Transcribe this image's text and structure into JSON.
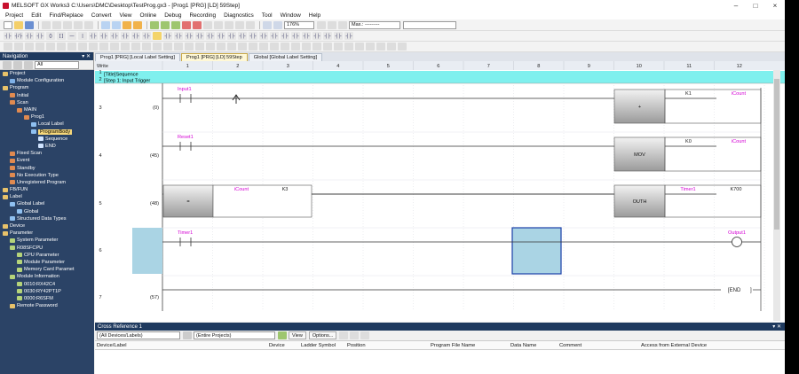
{
  "window": {
    "title": "MELSOFT GX Works3 C:\\Users\\DMC\\Desktop\\TestProg.gx3 - [Prog1 [PRG] [LD] 59Step]"
  },
  "menu": [
    "Project",
    "Edit",
    "Find/Replace",
    "Convert",
    "View",
    "Online",
    "Debug",
    "Recording",
    "Diagnostics",
    "Tool",
    "Window",
    "Help"
  ],
  "toolbar": {
    "zoom": "176%",
    "device_combo": "Max.: ---------"
  },
  "navigation": {
    "title": "Navigation",
    "filter": "All",
    "tree": [
      {
        "label": "Project",
        "depth": 0,
        "color": "#e8c26a"
      },
      {
        "label": "Module Configuration",
        "depth": 1,
        "color": "#7fb0e6"
      },
      {
        "label": "Program",
        "depth": 0,
        "color": "#e8c26a"
      },
      {
        "label": "Initial",
        "depth": 1,
        "color": "#e08a50"
      },
      {
        "label": "Scan",
        "depth": 1,
        "color": "#e08a50"
      },
      {
        "label": "MAIN",
        "depth": 2,
        "color": "#e08a50"
      },
      {
        "label": "Prog1",
        "depth": 3,
        "color": "#e08a50"
      },
      {
        "label": "Local Label",
        "depth": 4,
        "color": "#8fc0f0"
      },
      {
        "label": "ProgramBody",
        "depth": 4,
        "color": "#8fc0f0",
        "selected": true
      },
      {
        "label": "Sequence",
        "depth": 5,
        "color": "#cfe3ff"
      },
      {
        "label": "END",
        "depth": 5,
        "color": "#cfe3ff"
      },
      {
        "label": "Fixed Scan",
        "depth": 1,
        "color": "#e08a50"
      },
      {
        "label": "Event",
        "depth": 1,
        "color": "#e08a50"
      },
      {
        "label": "Standby",
        "depth": 1,
        "color": "#e08a50"
      },
      {
        "label": "No Execution Type",
        "depth": 1,
        "color": "#e08a50"
      },
      {
        "label": "Unregistered Program",
        "depth": 1,
        "color": "#e08a50"
      },
      {
        "label": "FB/FUN",
        "depth": 0,
        "color": "#e8c26a"
      },
      {
        "label": "Label",
        "depth": 0,
        "color": "#e8c26a"
      },
      {
        "label": "Global Label",
        "depth": 1,
        "color": "#8fc0f0"
      },
      {
        "label": "Global",
        "depth": 2,
        "color": "#8fc0f0"
      },
      {
        "label": "Structured Data Types",
        "depth": 1,
        "color": "#8fc0f0"
      },
      {
        "label": "Device",
        "depth": 0,
        "color": "#e8c26a"
      },
      {
        "label": "Parameter",
        "depth": 0,
        "color": "#e8c26a"
      },
      {
        "label": "System Parameter",
        "depth": 1,
        "color": "#b5d47a"
      },
      {
        "label": "R08SFCPU",
        "depth": 1,
        "color": "#b5d47a"
      },
      {
        "label": "CPU Parameter",
        "depth": 2,
        "color": "#b5d47a"
      },
      {
        "label": "Module Parameter",
        "depth": 2,
        "color": "#b5d47a"
      },
      {
        "label": "Memory Card Paramet",
        "depth": 2,
        "color": "#b5d47a"
      },
      {
        "label": "Module Information",
        "depth": 1,
        "color": "#b5d47a"
      },
      {
        "label": "0010:RX42C4",
        "depth": 2,
        "color": "#b5d47a"
      },
      {
        "label": "0030:RY42PT1P",
        "depth": 2,
        "color": "#b5d47a"
      },
      {
        "label": "0000:R6SFM",
        "depth": 2,
        "color": "#b5d47a"
      },
      {
        "label": "Remote Password",
        "depth": 1,
        "color": "#e8c26a"
      }
    ]
  },
  "tabs": [
    {
      "label": "Prog1 [PRG] [Local Label Setting]",
      "active": false
    },
    {
      "label": "Prog1 [PRG] [LD] 59Step",
      "active": true
    },
    {
      "label": "Global [Global Label Setting]",
      "active": false
    }
  ],
  "ladder": {
    "write_label": "Write",
    "columns": [
      "1",
      "2",
      "3",
      "4",
      "5",
      "6",
      "7",
      "8",
      "9",
      "10",
      "11",
      "12"
    ],
    "title_row": "[Title]Sequence",
    "step_row": "[Step 1: Input Trigger",
    "row_numbers": [
      "1",
      "2",
      "3",
      "4",
      "5",
      "6",
      "7"
    ],
    "steps": [
      "(0)",
      "(45)",
      "(48)",
      "(55)",
      "(57)"
    ],
    "contacts": [
      "Input1",
      "Reset1",
      "Timer1"
    ],
    "labels": {
      "icount": "iCount",
      "k1": "K1",
      "k0": "K0",
      "k3": "K3",
      "timer1": "Timer1",
      "k700": "K700",
      "output1": "Output1"
    },
    "instructions": {
      "plus": "+",
      "mov": "MOV",
      "eq": "=",
      "outh": "OUTH"
    },
    "end": "END"
  },
  "crossref": {
    "title": "Cross Reference 1",
    "filter1": "(All Devices/Labels)",
    "filter2": "(Entire Projects)",
    "view_label": "View",
    "options_label": "Options...",
    "columns": [
      "Device/Label",
      "Device",
      "Ladder Symbol",
      "Position",
      "Program File Name",
      "Data Name",
      "Comment",
      "Access from External Device"
    ]
  },
  "colors": {
    "accent_nav": "#1f3a5f",
    "label_magenta": "#d400d4",
    "selection": "#aad4e4",
    "title_cyan": "#7ff0ee"
  }
}
